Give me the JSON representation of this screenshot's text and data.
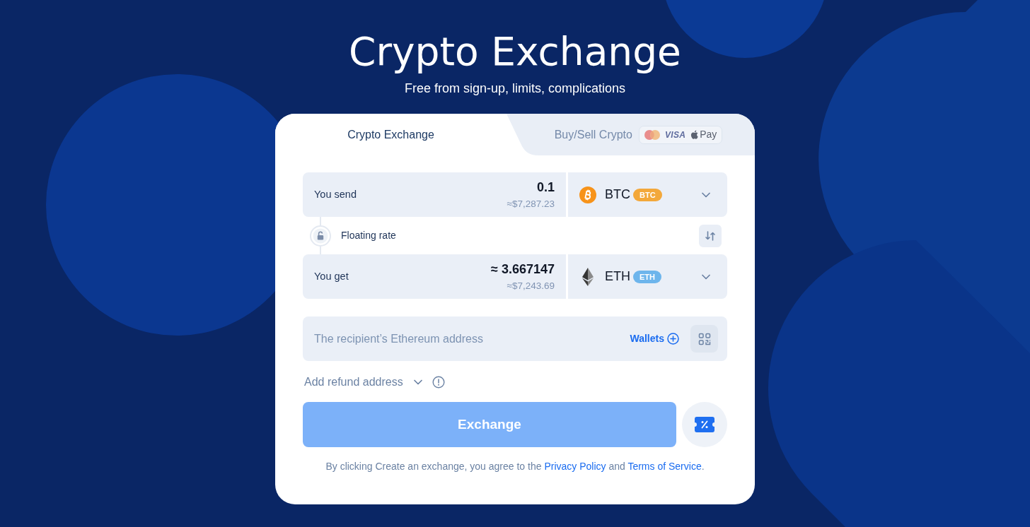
{
  "header": {
    "title": "Crypto Exchange",
    "subtitle": "Free from sign-up, limits, complications"
  },
  "tabs": [
    {
      "label": "Crypto Exchange",
      "selected": true
    },
    {
      "label": "Buy/Sell Crypto",
      "selected": false,
      "payment_methods": [
        {
          "kind": "card-circles"
        },
        {
          "kind": "wordmark",
          "label": "VISA"
        },
        {
          "kind": "apple",
          "label": "Pay"
        }
      ]
    }
  ],
  "exchange": [
    {
      "kind": "amount",
      "label": "You send",
      "amount": "0.1",
      "fiat_value": "≈$7,287.23",
      "currency": {
        "kind": "bitcoin",
        "code": "BTC",
        "badge": "BTC",
        "color": "#f3a83b"
      }
    },
    {
      "kind": "rate",
      "label": "Floating rate",
      "locked": false
    },
    {
      "kind": "amount",
      "label": "You get",
      "amount": "≈ 3.667147",
      "fiat_value": "≈$7,243.69",
      "currency": {
        "kind": "ether",
        "code": "ETH",
        "badge": "ETH",
        "color": "#6db5ec"
      }
    }
  ],
  "address": {
    "placeholder": "The recipient’s Ethereum address",
    "wallets_link": "Wallets"
  },
  "refund": {
    "label": "Add refund address",
    "expanded": false
  },
  "submit": {
    "label": "Exchange",
    "disabled": true
  },
  "legal": [
    {
      "kind": "text",
      "text": "By clicking Create an exchange, you agree to the "
    },
    {
      "kind": "link",
      "text": "Privacy Policy"
    },
    {
      "kind": "text",
      "text": " and "
    },
    {
      "kind": "link",
      "text": "Terms of Service"
    },
    {
      "kind": "text",
      "text": "."
    }
  ]
}
